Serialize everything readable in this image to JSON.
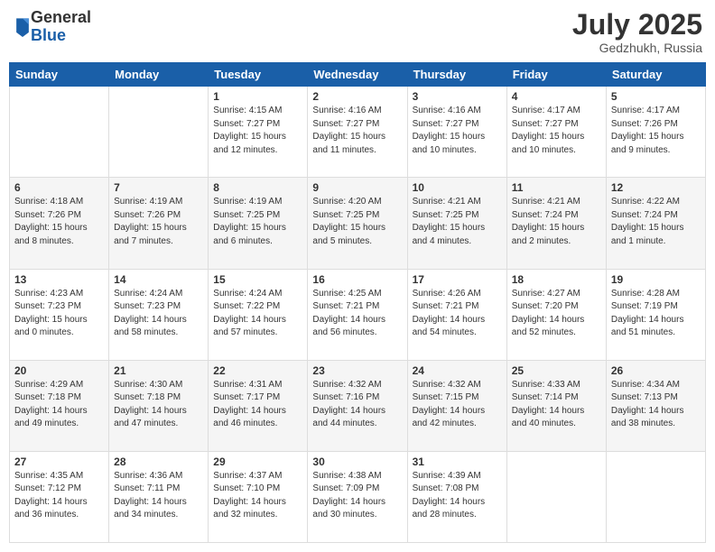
{
  "header": {
    "logo_general": "General",
    "logo_blue": "Blue",
    "month": "July 2025",
    "location": "Gedzhukh, Russia"
  },
  "weekdays": [
    "Sunday",
    "Monday",
    "Tuesday",
    "Wednesday",
    "Thursday",
    "Friday",
    "Saturday"
  ],
  "weeks": [
    [
      {
        "day": "",
        "info": ""
      },
      {
        "day": "",
        "info": ""
      },
      {
        "day": "1",
        "info": "Sunrise: 4:15 AM\nSunset: 7:27 PM\nDaylight: 15 hours and 12 minutes."
      },
      {
        "day": "2",
        "info": "Sunrise: 4:16 AM\nSunset: 7:27 PM\nDaylight: 15 hours and 11 minutes."
      },
      {
        "day": "3",
        "info": "Sunrise: 4:16 AM\nSunset: 7:27 PM\nDaylight: 15 hours and 10 minutes."
      },
      {
        "day": "4",
        "info": "Sunrise: 4:17 AM\nSunset: 7:27 PM\nDaylight: 15 hours and 10 minutes."
      },
      {
        "day": "5",
        "info": "Sunrise: 4:17 AM\nSunset: 7:26 PM\nDaylight: 15 hours and 9 minutes."
      }
    ],
    [
      {
        "day": "6",
        "info": "Sunrise: 4:18 AM\nSunset: 7:26 PM\nDaylight: 15 hours and 8 minutes."
      },
      {
        "day": "7",
        "info": "Sunrise: 4:19 AM\nSunset: 7:26 PM\nDaylight: 15 hours and 7 minutes."
      },
      {
        "day": "8",
        "info": "Sunrise: 4:19 AM\nSunset: 7:25 PM\nDaylight: 15 hours and 6 minutes."
      },
      {
        "day": "9",
        "info": "Sunrise: 4:20 AM\nSunset: 7:25 PM\nDaylight: 15 hours and 5 minutes."
      },
      {
        "day": "10",
        "info": "Sunrise: 4:21 AM\nSunset: 7:25 PM\nDaylight: 15 hours and 4 minutes."
      },
      {
        "day": "11",
        "info": "Sunrise: 4:21 AM\nSunset: 7:24 PM\nDaylight: 15 hours and 2 minutes."
      },
      {
        "day": "12",
        "info": "Sunrise: 4:22 AM\nSunset: 7:24 PM\nDaylight: 15 hours and 1 minute."
      }
    ],
    [
      {
        "day": "13",
        "info": "Sunrise: 4:23 AM\nSunset: 7:23 PM\nDaylight: 15 hours and 0 minutes."
      },
      {
        "day": "14",
        "info": "Sunrise: 4:24 AM\nSunset: 7:23 PM\nDaylight: 14 hours and 58 minutes."
      },
      {
        "day": "15",
        "info": "Sunrise: 4:24 AM\nSunset: 7:22 PM\nDaylight: 14 hours and 57 minutes."
      },
      {
        "day": "16",
        "info": "Sunrise: 4:25 AM\nSunset: 7:21 PM\nDaylight: 14 hours and 56 minutes."
      },
      {
        "day": "17",
        "info": "Sunrise: 4:26 AM\nSunset: 7:21 PM\nDaylight: 14 hours and 54 minutes."
      },
      {
        "day": "18",
        "info": "Sunrise: 4:27 AM\nSunset: 7:20 PM\nDaylight: 14 hours and 52 minutes."
      },
      {
        "day": "19",
        "info": "Sunrise: 4:28 AM\nSunset: 7:19 PM\nDaylight: 14 hours and 51 minutes."
      }
    ],
    [
      {
        "day": "20",
        "info": "Sunrise: 4:29 AM\nSunset: 7:18 PM\nDaylight: 14 hours and 49 minutes."
      },
      {
        "day": "21",
        "info": "Sunrise: 4:30 AM\nSunset: 7:18 PM\nDaylight: 14 hours and 47 minutes."
      },
      {
        "day": "22",
        "info": "Sunrise: 4:31 AM\nSunset: 7:17 PM\nDaylight: 14 hours and 46 minutes."
      },
      {
        "day": "23",
        "info": "Sunrise: 4:32 AM\nSunset: 7:16 PM\nDaylight: 14 hours and 44 minutes."
      },
      {
        "day": "24",
        "info": "Sunrise: 4:32 AM\nSunset: 7:15 PM\nDaylight: 14 hours and 42 minutes."
      },
      {
        "day": "25",
        "info": "Sunrise: 4:33 AM\nSunset: 7:14 PM\nDaylight: 14 hours and 40 minutes."
      },
      {
        "day": "26",
        "info": "Sunrise: 4:34 AM\nSunset: 7:13 PM\nDaylight: 14 hours and 38 minutes."
      }
    ],
    [
      {
        "day": "27",
        "info": "Sunrise: 4:35 AM\nSunset: 7:12 PM\nDaylight: 14 hours and 36 minutes."
      },
      {
        "day": "28",
        "info": "Sunrise: 4:36 AM\nSunset: 7:11 PM\nDaylight: 14 hours and 34 minutes."
      },
      {
        "day": "29",
        "info": "Sunrise: 4:37 AM\nSunset: 7:10 PM\nDaylight: 14 hours and 32 minutes."
      },
      {
        "day": "30",
        "info": "Sunrise: 4:38 AM\nSunset: 7:09 PM\nDaylight: 14 hours and 30 minutes."
      },
      {
        "day": "31",
        "info": "Sunrise: 4:39 AM\nSunset: 7:08 PM\nDaylight: 14 hours and 28 minutes."
      },
      {
        "day": "",
        "info": ""
      },
      {
        "day": "",
        "info": ""
      }
    ]
  ]
}
